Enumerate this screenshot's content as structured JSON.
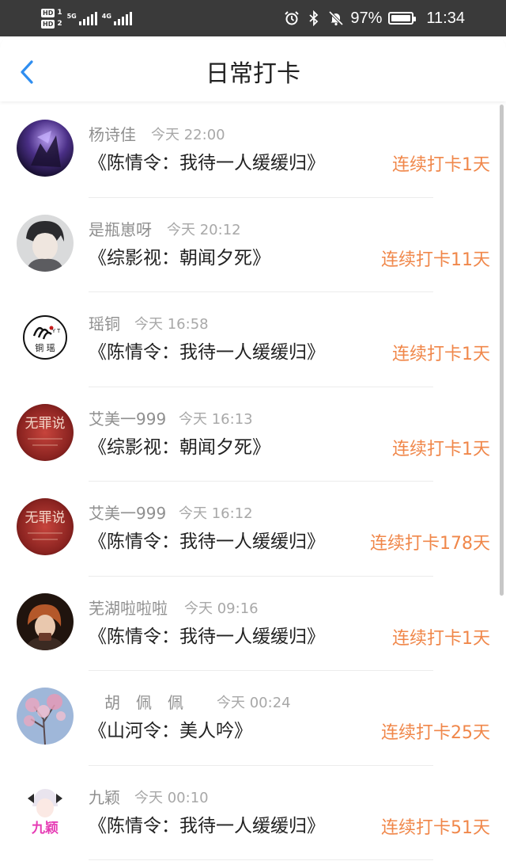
{
  "status_bar": {
    "sim1": {
      "badge": "HD",
      "num": "1"
    },
    "sim2": {
      "badge": "HD",
      "num": "2"
    },
    "net1": "5G",
    "net2": "4G",
    "battery": "97%",
    "time": "11:34",
    "color": "#3a3a3a"
  },
  "header": {
    "title": "日常打卡",
    "back_icon": "chevron-left-icon",
    "accent": "#2f8ef0"
  },
  "checkins": [
    {
      "name": "杨诗佳",
      "time": "今天 22:00",
      "book": "《陈情令：我待一人缓缓归》",
      "streak": "连续打卡1天"
    },
    {
      "name": "是瓶崽呀",
      "time": "今天 20:12",
      "book": "《综影视：朝闻夕死》",
      "streak": "连续打卡11天"
    },
    {
      "name": "瑶铜",
      "time": "今天 16:58",
      "book": "《陈情令：我待一人缓缓归》",
      "streak": "连续打卡1天"
    },
    {
      "name": "艾美一999",
      "time": "今天 16:13",
      "book": "《综影视：朝闻夕死》",
      "streak": "连续打卡1天"
    },
    {
      "name": "艾美一999",
      "time": "今天 16:12",
      "book": "《陈情令：我待一人缓缓归》",
      "streak": "连续打卡178天"
    },
    {
      "name": "芜湖啦啦啦",
      "time": "今天 09:16",
      "book": "《陈情令：我待一人缓缓归》",
      "streak": "连续打卡1天"
    },
    {
      "name": "胡　佩　佩",
      "time": "今天 00:24",
      "book": "《山河令：美人吟》",
      "streak": "连续打卡25天"
    },
    {
      "name": "九颖",
      "time": "今天 00:10",
      "book": "《陈情令：我待一人缓缓归》",
      "streak": "连续打卡51天"
    }
  ],
  "avatar_labels": {
    "tongyao_top": "Y T",
    "tongyao_bottom": "铜 瑶",
    "aimei": "无罪说",
    "jiuying": "九颖"
  },
  "colors": {
    "streak": "#f0874a",
    "name": "#8f8f8f",
    "book": "#222222"
  }
}
